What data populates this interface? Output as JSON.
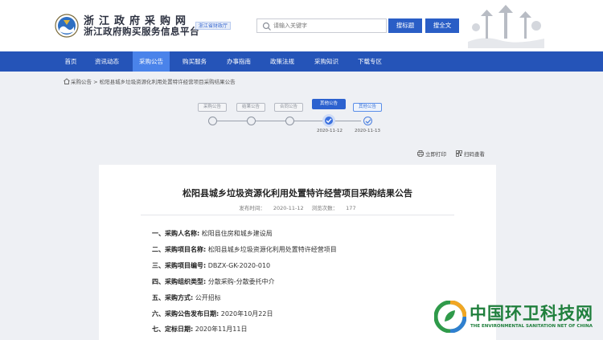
{
  "header": {
    "title_line1": "浙江政府采购网",
    "title_line2": "浙江政府购买服务信息平台",
    "badge": "浙江省财政厅",
    "search_placeholder": "请输入关键字",
    "search_button": "搜标题",
    "search_all_button": "搜全文"
  },
  "nav": {
    "items": [
      "首页",
      "资讯动态",
      "采购公告",
      "购买服务",
      "办事指南",
      "政策法规",
      "采购知识",
      "下载专区"
    ],
    "active_index": 2
  },
  "breadcrumb": {
    "root": "采购公告",
    "separator": ">",
    "current": "松阳县城乡垃圾资源化利用处置特许经营项目采购结果公告"
  },
  "progress": {
    "steps": [
      "采购公告",
      "结果公告",
      "合同公告",
      "其他公告",
      "其他公告"
    ],
    "dates": [
      "",
      "",
      "",
      "2020-11-12",
      "2020-11-13"
    ],
    "current_index": 3
  },
  "tools": {
    "print": "立即打印",
    "scan": "扫码查看"
  },
  "article": {
    "title": "松阳县城乡垃圾资源化利用处置特许经营项目采购结果公告",
    "publish_label": "发布时间：",
    "publish_time": "2020-11-12",
    "views_label": "浏览次数：",
    "views": "177",
    "items": [
      {
        "num": "一、",
        "label": "采购人名称:",
        "value": "松阳县住房和城乡建设局"
      },
      {
        "num": "二、",
        "label": "采购项目名称:",
        "value": "松阳县城乡垃圾资源化利用处置特许经营项目"
      },
      {
        "num": "三、",
        "label": "采购项目编号:",
        "value": "DBZX-GK-2020-010"
      },
      {
        "num": "四、",
        "label": "采购组织类型:",
        "value": "分散采购-分散委托中介"
      },
      {
        "num": "五、",
        "label": "采购方式:",
        "value": "公开招标"
      },
      {
        "num": "六、",
        "label": "采购公告发布日期:",
        "value": "2020年10月22日"
      },
      {
        "num": "七、",
        "label": "定标日期:",
        "value": "2020年11月11日"
      }
    ]
  },
  "watermark": {
    "title": "中国环卫科技网",
    "subtitle": "THE ENVIRONMENTAL SANITATION NET OF CHINA"
  },
  "colors": {
    "nav_bg": "#2554b8",
    "nav_active": "#4a83ea",
    "accent": "#2a5ec6",
    "watermark_green": "#1f7f3c",
    "page_bg": "#eef0f4"
  }
}
